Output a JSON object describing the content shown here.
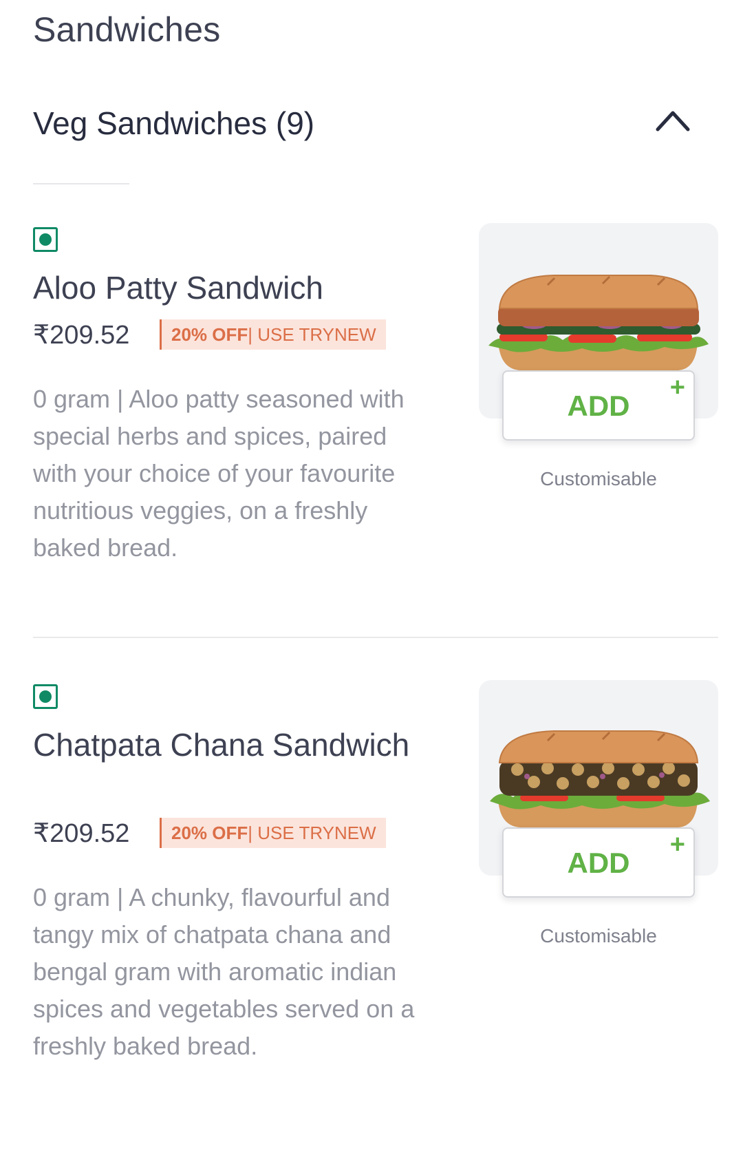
{
  "category": {
    "title": "Sandwiches"
  },
  "subcategory": {
    "title": "Veg Sandwiches (9)"
  },
  "items": [
    {
      "name": "Aloo Patty Sandwich",
      "price": "₹209.52",
      "offer_pct": "20% OFF",
      "offer_code": " | USE TRYNEW",
      "description": "0 gram | Aloo patty seasoned with special herbs and spices, paired with your choice of your favourite nutritious veggies, on a freshly baked bread.",
      "add_label": "ADD",
      "add_plus": "+",
      "customisable": "Customisable",
      "image": "aloo-patty-sandwich-image"
    },
    {
      "name": "Chatpata Chana Sandwich",
      "price": "₹209.52",
      "offer_pct": "20% OFF",
      "offer_code": " | USE TRYNEW",
      "description": "0 gram | A chunky, flavourful and tangy mix of chatpata chana and bengal gram with aromatic indian spices and vegetables served on a freshly baked bread.",
      "add_label": "ADD",
      "add_plus": "+",
      "customisable": "Customisable",
      "image": "chatpata-chana-sandwich-image"
    }
  ],
  "icons": {
    "collapse": "chevron-up-icon",
    "veg": "veg-indicator-icon"
  },
  "colors": {
    "veg_green": "#0f8a65",
    "add_green": "#60b246",
    "offer_orange": "#db6e47",
    "offer_bg": "#fbe4dc"
  }
}
